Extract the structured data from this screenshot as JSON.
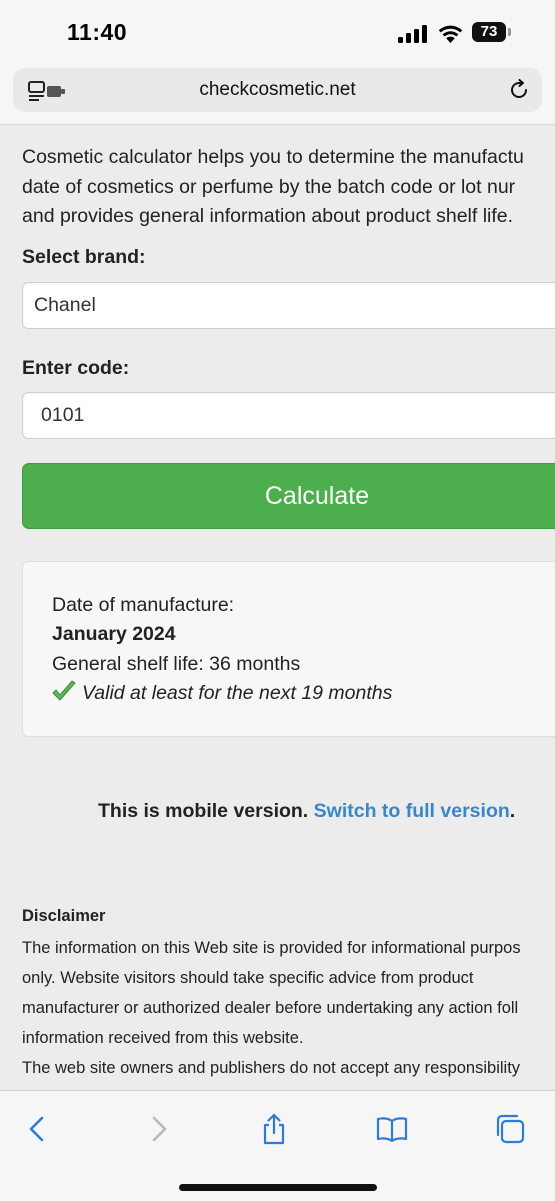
{
  "status_bar": {
    "time": "11:40",
    "battery": "73",
    "battery_level": 0.73
  },
  "browser": {
    "url": "checkcosmetic.net"
  },
  "page": {
    "intro_lines": [
      "Cosmetic calculator helps you to determine the manufactu",
      "date of cosmetics or perfume by the batch code or lot nur",
      "and provides general information about product shelf life."
    ],
    "brand_label": "Select brand:",
    "brand_value": "Chanel",
    "code_label": "Enter code:",
    "code_value": "0101",
    "calculate_label": "Calculate",
    "result": {
      "manufacture_label": "Date of manufacture:",
      "manufacture_date": "January 2024",
      "shelf_life": "General shelf life: 36 months",
      "validity": "Valid at least for the next 19 months"
    },
    "mobile_note": {
      "text": "This is mobile version. ",
      "link": "Switch to full version",
      "end": "."
    },
    "disclaimer": {
      "title": "Disclaimer",
      "lines": [
        "The information on this Web site is provided for informational purpos",
        "only. Website visitors should take specific advice from product",
        "manufacturer or authorized dealer before undertaking any action foll",
        "information received from this website.",
        "The web site owners and publishers do not accept any responsibility"
      ]
    }
  },
  "colors": {
    "accent_green": "#4cae4c",
    "link_blue": "#3a86c8",
    "toolbar_blue": "#2f7bd6",
    "check_green": "#5cb85c"
  },
  "icons": {
    "back": "chevron-left-icon",
    "forward": "chevron-right-icon",
    "share": "share-icon",
    "bookmarks": "book-icon",
    "tabs": "tabs-icon"
  }
}
